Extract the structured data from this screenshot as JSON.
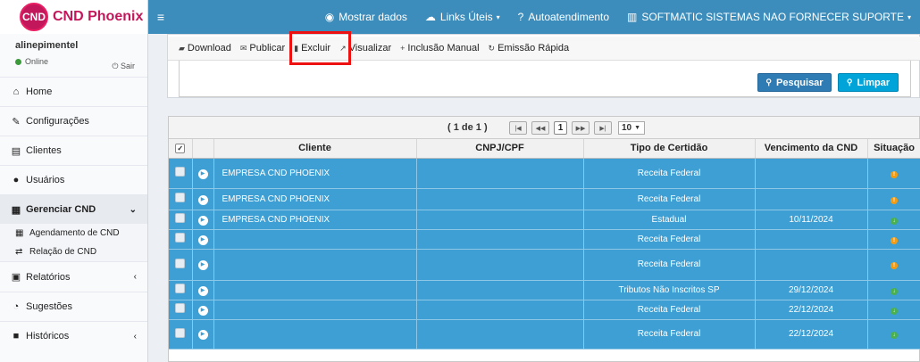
{
  "app": {
    "logo_badge": "CND",
    "logo_text": "CND Phoenix"
  },
  "user": {
    "name": "alinepimentel",
    "status": "Online",
    "logout": "Sair"
  },
  "sidebar": {
    "items": [
      {
        "label": "Home",
        "icon": "home-icon"
      },
      {
        "label": "Configurações",
        "icon": "wrench-icon"
      },
      {
        "label": "Clientes",
        "icon": "book-icon"
      },
      {
        "label": "Usuários",
        "icon": "user-icon"
      },
      {
        "label": "Gerenciar CND",
        "icon": "calendar-icon",
        "active": true
      },
      {
        "label": "Relatórios",
        "icon": "document-icon"
      },
      {
        "label": "Sugestões",
        "icon": "comments-icon"
      },
      {
        "label": "Históricos",
        "icon": "archive-icon"
      }
    ],
    "subitems": [
      {
        "label": "Agendamento de CND",
        "icon": "calendar-icon"
      },
      {
        "label": "Relação de CND",
        "icon": "exchange-icon"
      }
    ]
  },
  "navbar": {
    "mostrar": "Mostrar dados",
    "links": "Links Úteis",
    "auto": "Autoatendimento",
    "softmatic": "SOFTMATIC SISTEMAS NAO FORNECER SUPORTE"
  },
  "toolbar": {
    "download": "Download",
    "publicar": "Publicar",
    "excluir": "Excluir",
    "visualizar": "Visualizar",
    "inclusao": "Inclusão Manual",
    "emissao": "Emissão Rápida"
  },
  "search": {
    "pesquisar": "Pesquisar",
    "limpar": "Limpar"
  },
  "paginator": {
    "info": "( 1 de 1 )",
    "current_page": "1",
    "rows_per_page": "10"
  },
  "table": {
    "headers": {
      "cliente": "Cliente",
      "cnpj": "CNPJ/CPF",
      "tipo": "Tipo de Certidão",
      "vencimento": "Vencimento da CND",
      "situacao": "Situação"
    },
    "rows": [
      {
        "cliente": "EMPRESA CND PHOENIX",
        "tipo": "Receita Federal",
        "vencimento": "",
        "situacao": "orange"
      },
      {
        "cliente": "EMPRESA CND PHOENIX",
        "tipo": "Receita Federal",
        "vencimento": "",
        "situacao": "orange"
      },
      {
        "cliente": "EMPRESA CND PHOENIX",
        "tipo": "Estadual",
        "vencimento": "10/11/2024",
        "situacao": "green"
      },
      {
        "cliente": "",
        "tipo": "Receita Federal",
        "vencimento": "",
        "situacao": "orange"
      },
      {
        "cliente": "",
        "tipo": "Receita Federal",
        "vencimento": "",
        "situacao": "orange"
      },
      {
        "cliente": "",
        "tipo": "Tributos Não Inscritos SP",
        "vencimento": "29/12/2024",
        "situacao": "green"
      },
      {
        "cliente": "",
        "tipo": "Receita Federal",
        "vencimento": "22/12/2024",
        "situacao": "green"
      },
      {
        "cliente": "",
        "tipo": "Receita Federal",
        "vencimento": "22/12/2024",
        "situacao": "green"
      }
    ]
  },
  "colors": {
    "navbar": "#3c8dbc",
    "row_selected": "#3d9fd3",
    "brand": "#c2185b",
    "highlight": "#ee1111"
  }
}
